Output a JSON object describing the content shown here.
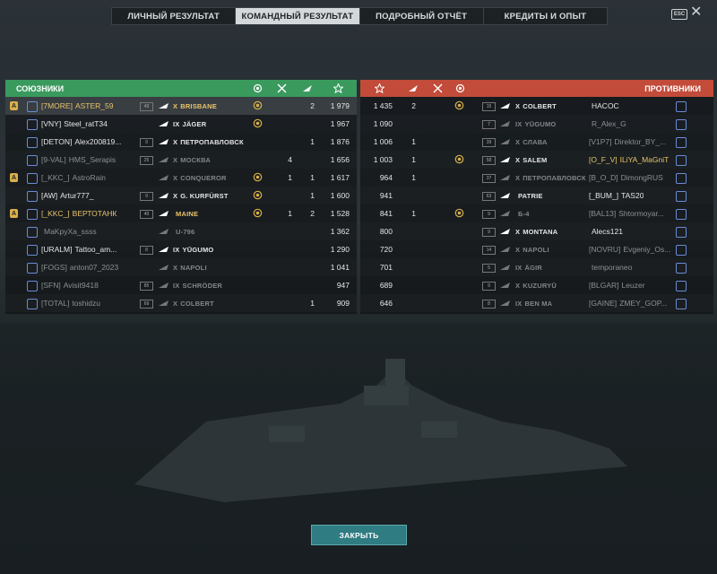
{
  "tabs": [
    {
      "label": "ЛИЧНЫЙ РЕЗУЛЬТАТ",
      "active": false
    },
    {
      "label": "КОМАНДНЫЙ РЕЗУЛЬТАТ",
      "active": true
    },
    {
      "label": "ПОДРОБНЫЙ ОТЧЁТ",
      "active": false
    },
    {
      "label": "КРЕДИТЫ И ОПЫТ",
      "active": false
    }
  ],
  "esc_label": "ESC",
  "close_x": "✕",
  "allies": {
    "title": "СОЮЗНИКИ",
    "players": [
      {
        "div": "A",
        "clan": "[7MORE]",
        "name": "ASTER_59",
        "level": "49",
        "tier": "X",
        "ship": "BRISBANE",
        "medal": true,
        "kills": "",
        "planes": "2",
        "xp": "1 979",
        "highlight": true,
        "gold": true,
        "dim": false
      },
      {
        "div": "",
        "clan": "[VNY]",
        "name": "Steel_ratT34",
        "level": "",
        "tier": "IX",
        "ship": "JÄGER",
        "medal": true,
        "kills": "",
        "planes": "",
        "xp": "1 967",
        "highlight": false,
        "gold": false,
        "dim": false
      },
      {
        "div": "",
        "clan": "[DETON]",
        "name": "Alex200819...",
        "level": "9",
        "tier": "X",
        "ship": "ПЕТРОПАВЛОВСК",
        "medal": false,
        "kills": "",
        "planes": "1",
        "xp": "1 876",
        "highlight": false,
        "gold": false,
        "dim": false
      },
      {
        "div": "",
        "clan": "[9-VAL]",
        "name": "HMS_Serapis",
        "level": "25",
        "tier": "X",
        "ship": "МОСКВА",
        "medal": false,
        "kills": "4",
        "planes": "",
        "xp": "1 656",
        "highlight": false,
        "gold": false,
        "dim": true
      },
      {
        "div": "A",
        "clan": "[_KKC_]",
        "name": "AstroRain",
        "level": "",
        "tier": "X",
        "ship": "CONQUEROR",
        "medal": true,
        "kills": "1",
        "planes": "1",
        "xp": "1 617",
        "highlight": false,
        "gold": false,
        "dim": true
      },
      {
        "div": "",
        "clan": "[AW]",
        "name": "Artur777_",
        "level": "9",
        "tier": "X",
        "ship": "G. KURFÜRST",
        "medal": true,
        "kills": "",
        "planes": "1",
        "xp": "1 600",
        "highlight": false,
        "gold": false,
        "dim": false
      },
      {
        "div": "A",
        "clan": "[_KKC_]",
        "name": "ВЕРТОТАНК",
        "level": "49",
        "tier": "",
        "ship": "MAINE",
        "medal": true,
        "kills": "1",
        "planes": "2",
        "xp": "1 528",
        "highlight": false,
        "gold": true,
        "dim": false
      },
      {
        "div": "",
        "clan": "",
        "name": "MaKpyXa_ssss",
        "level": "",
        "tier": "",
        "ship": "U-796",
        "medal": false,
        "kills": "",
        "planes": "",
        "xp": "1 362",
        "highlight": false,
        "gold": false,
        "dim": true
      },
      {
        "div": "",
        "clan": "[URALM]",
        "name": "Tattoo_am...",
        "level": "8",
        "tier": "IX",
        "ship": "YŪGUMO",
        "medal": false,
        "kills": "",
        "planes": "",
        "xp": "1 290",
        "highlight": false,
        "gold": false,
        "dim": false
      },
      {
        "div": "",
        "clan": "[FOGS]",
        "name": "anton07_2023",
        "level": "",
        "tier": "X",
        "ship": "NAPOLI",
        "medal": false,
        "kills": "",
        "planes": "",
        "xp": "1 041",
        "highlight": false,
        "gold": false,
        "dim": true
      },
      {
        "div": "",
        "clan": "[SFN]",
        "name": "Avisit9418",
        "level": "85",
        "tier": "IX",
        "ship": "SCHRÖDER",
        "medal": false,
        "kills": "",
        "planes": "",
        "xp": "947",
        "highlight": false,
        "gold": false,
        "dim": true
      },
      {
        "div": "",
        "clan": "[TOTAL]",
        "name": "toshidzu",
        "level": "69",
        "tier": "X",
        "ship": "COLBERT",
        "medal": false,
        "kills": "",
        "planes": "1",
        "xp": "909",
        "highlight": false,
        "gold": false,
        "dim": true
      }
    ]
  },
  "enemies": {
    "title": "ПРОТИВНИКИ",
    "players": [
      {
        "xp": "1 435",
        "planes": "2",
        "kills": "",
        "medal": true,
        "level": "15",
        "tier": "X",
        "ship": "COLBERT",
        "clan": "",
        "name": "HACOC",
        "dim": false,
        "gold": false
      },
      {
        "xp": "1 090",
        "planes": "",
        "kills": "",
        "medal": false,
        "level": "7",
        "tier": "IX",
        "ship": "YŪGUMO",
        "clan": "",
        "name": "R_Alex_G",
        "dim": true,
        "gold": false
      },
      {
        "xp": "1 006",
        "planes": "1",
        "kills": "",
        "medal": false,
        "level": "39",
        "tier": "X",
        "ship": "СЛАВА",
        "clan": "[V1P7]",
        "name": "Direktor_BY_...",
        "dim": true,
        "gold": false
      },
      {
        "xp": "1 003",
        "planes": "1",
        "kills": "",
        "medal": true,
        "level": "58",
        "tier": "X",
        "ship": "SALEM",
        "clan": "[O_F_V]",
        "name": "ILiYA_MaGniT",
        "dim": false,
        "gold": true
      },
      {
        "xp": "964",
        "planes": "1",
        "kills": "",
        "medal": false,
        "level": "37",
        "tier": "X",
        "ship": "ПЕТРОПАВЛОВСК",
        "clan": "[B_O_D]",
        "name": "DimongRUS",
        "dim": true,
        "gold": false
      },
      {
        "xp": "941",
        "planes": "",
        "kills": "",
        "medal": false,
        "level": "63",
        "tier": "",
        "ship": "PATRIE",
        "clan": "[_BUM_]",
        "name": "TAS20",
        "dim": false,
        "gold": false
      },
      {
        "xp": "841",
        "planes": "1",
        "kills": "",
        "medal": true,
        "level": "9",
        "tier": "",
        "ship": "Б-4",
        "clan": "[BAL13]",
        "name": "Shtormoyar...",
        "dim": true,
        "gold": false
      },
      {
        "xp": "800",
        "planes": "",
        "kills": "",
        "medal": false,
        "level": "9",
        "tier": "X",
        "ship": "MONTANA",
        "clan": "",
        "name": "Alecs121",
        "dim": false,
        "gold": false
      },
      {
        "xp": "720",
        "planes": "",
        "kills": "",
        "medal": false,
        "level": "14",
        "tier": "X",
        "ship": "NAPOLI",
        "clan": "[NOVRU]",
        "name": "Evgeniy_Os...",
        "dim": true,
        "gold": false
      },
      {
        "xp": "701",
        "planes": "",
        "kills": "",
        "medal": false,
        "level": "5",
        "tier": "IX",
        "ship": "ÄGIR",
        "clan": "",
        "name": "temporaneo",
        "dim": true,
        "gold": false
      },
      {
        "xp": "689",
        "planes": "",
        "kills": "",
        "medal": false,
        "level": "9",
        "tier": "X",
        "ship": "KUZURYŪ",
        "clan": "[BLGAR]",
        "name": "Leuzer",
        "dim": true,
        "gold": false
      },
      {
        "xp": "646",
        "planes": "",
        "kills": "",
        "medal": false,
        "level": "8",
        "tier": "IX",
        "ship": "BEN MA",
        "clan": "[GAINE]",
        "name": "ZMEY_GOP...",
        "dim": true,
        "gold": false
      }
    ]
  },
  "close_button": "ЗАКРЫТЬ",
  "colors": {
    "allies": "#3a9a5e",
    "enemies": "#c24b3a",
    "gold": "#e9c46a",
    "button": "#2f7c82"
  }
}
